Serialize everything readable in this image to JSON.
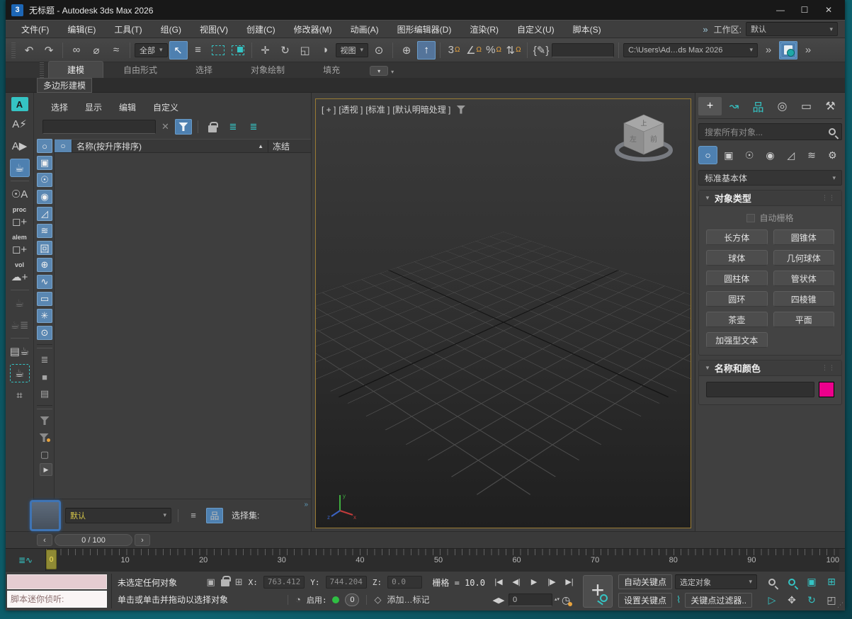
{
  "colors": {
    "accent_teal": "#35c4c4",
    "highlight_blue": "#4e80b0",
    "swatch_pink": "#ec008c",
    "active_viewport_border": "#9a7b33",
    "marker_yellow": "#8f8a35"
  },
  "window": {
    "app_badge": "3",
    "title": "无标题 - Autodesk 3ds Max 2026",
    "minimize": "—",
    "maximize": "☐",
    "close": "✕"
  },
  "menubar": {
    "items": [
      "文件(F)",
      "编辑(E)",
      "工具(T)",
      "组(G)",
      "视图(V)",
      "创建(C)",
      "修改器(M)",
      "动画(A)",
      "图形编辑器(D)",
      "渲染(R)",
      "自定义(U)",
      "脚本(S)"
    ],
    "overflow": "»",
    "workspace_label": "工作区:",
    "workspace_value": "默认"
  },
  "toolbar": {
    "items": [
      {
        "name": "undo-icon",
        "glyph": "↶"
      },
      {
        "name": "redo-icon",
        "glyph": "↷"
      },
      {
        "kind": "sep"
      },
      {
        "name": "select-and-link-icon",
        "glyph": "∞"
      },
      {
        "name": "unlink-selection-icon",
        "glyph": "⌀"
      },
      {
        "name": "bind-to-space-warp-icon",
        "glyph": "≈"
      },
      {
        "kind": "sep"
      },
      {
        "kind": "dropdown",
        "name": "selection-filter-dropdown",
        "value": "全部"
      },
      {
        "name": "select-object-icon",
        "glyph": "↖",
        "active": true
      },
      {
        "name": "select-by-name-icon",
        "glyph": "≡"
      },
      {
        "name": "rect-selection-region-icon",
        "css": "i-dash"
      },
      {
        "name": "window-crossing-icon",
        "css": "i-dash fill"
      },
      {
        "kind": "sep"
      },
      {
        "name": "select-and-move-icon",
        "glyph": "✛"
      },
      {
        "name": "select-and-rotate-icon",
        "glyph": "↻"
      },
      {
        "name": "select-and-scale-icon",
        "glyph": "◱"
      },
      {
        "name": "select-and-place-icon",
        "glyph": "◑"
      },
      {
        "kind": "dropdown",
        "name": "reference-coordinate-dropdown",
        "value": "视图"
      },
      {
        "name": "use-pivot-center-icon",
        "glyph": "⊙"
      },
      {
        "kind": "sep"
      },
      {
        "name": "select-and-manipulate-icon",
        "glyph": "⊕"
      },
      {
        "name": "keyboard-override-icon",
        "glyph": "↑",
        "active": true,
        "css": "boxed"
      },
      {
        "kind": "sep"
      },
      {
        "name": "snaps-toggle-3d-icon",
        "glyph": "3",
        "glyph2": "Ω"
      },
      {
        "name": "angle-snap-icon",
        "glyph": "∠",
        "glyph2": "Ω"
      },
      {
        "name": "percent-snap-icon",
        "glyph": "%",
        "glyph2": "Ω"
      },
      {
        "name": "spinner-snap-icon",
        "glyph": "⇅",
        "glyph2": "Ω"
      },
      {
        "kind": "sep"
      },
      {
        "name": "edit-named-selections-icon",
        "glyph": "{✎}"
      },
      {
        "kind": "field",
        "name": "named-selection-field",
        "value": "",
        "css": "w90"
      },
      {
        "kind": "sep"
      },
      {
        "kind": "dropdown",
        "name": "project-folder-dropdown",
        "value": "C:\\Users\\Ad…ds Max 2026",
        "css": "mono"
      },
      {
        "name": "toolbar-overflow-icon",
        "glyph": "»",
        "css": "tb-ovf"
      },
      {
        "name": "autosave-icon",
        "css": "i-disk",
        "active": true
      },
      {
        "name": "toolbar-overflow2-icon",
        "glyph": "»",
        "css": "tb-ovf"
      }
    ]
  },
  "ribbon": {
    "tabs": [
      {
        "name": "tab-modeling",
        "label": "建模",
        "active": true
      },
      {
        "name": "tab-freeform",
        "label": "自由形式"
      },
      {
        "name": "tab-selection",
        "label": "选择"
      },
      {
        "name": "tab-object-paint",
        "label": "对象绘制"
      },
      {
        "name": "tab-populate",
        "label": "填充"
      }
    ],
    "more_glyph": "▾",
    "subtab": "多边形建模"
  },
  "dock": {
    "items": [
      {
        "name": "script-editor-button",
        "glyph": "A",
        "css": "teal-box"
      },
      {
        "name": "script-run-button",
        "glyph": "A⚡"
      },
      {
        "name": "script-play-button",
        "glyph": "A▶"
      },
      {
        "name": "render-setup-button",
        "glyph": "☕",
        "active": true
      },
      {
        "kind": "sep"
      },
      {
        "name": "light-explorer-button",
        "glyph": "☉A"
      },
      {
        "name": "create-proc-button",
        "label": "proc",
        "glyph": "◻+"
      },
      {
        "name": "create-alem-button",
        "label": "alem",
        "glyph": "◻+"
      },
      {
        "name": "create-vol-button",
        "label": "vol",
        "glyph": "☁+"
      },
      {
        "kind": "sep"
      },
      {
        "name": "render-last-button",
        "glyph": "☕",
        "disabled": true
      },
      {
        "name": "render-list-button",
        "glyph": "☕≣",
        "disabled": true
      },
      {
        "kind": "sep"
      },
      {
        "name": "frame-buffer-button",
        "glyph": "▤☕"
      },
      {
        "name": "render-region-button",
        "glyph": "☕",
        "css": "dashed"
      },
      {
        "name": "state-sets-button",
        "glyph": "⌗"
      }
    ]
  },
  "explorer": {
    "menu": [
      "选择",
      "显示",
      "编辑",
      "自定义"
    ],
    "search_value": "",
    "clear_glyph": "✕",
    "name_column": "名称(按升序排序)",
    "sort_glyph": "▲",
    "frozen_column": "冻结",
    "type_header_glyph": "○",
    "filters": [
      {
        "name": "filter-geometry-icon",
        "glyph": "○",
        "active": true
      },
      {
        "name": "filter-shapes-icon",
        "glyph": "▣",
        "active": true
      },
      {
        "name": "filter-lights-icon",
        "glyph": "☉",
        "active": true
      },
      {
        "name": "filter-cameras-icon",
        "glyph": "◉",
        "active": true
      },
      {
        "name": "filter-helpers-icon",
        "glyph": "◿",
        "active": true
      },
      {
        "name": "filter-space-warps-icon",
        "glyph": "≋",
        "active": true
      },
      {
        "name": "filter-xrefs-icon",
        "glyph": "回",
        "active": true
      },
      {
        "name": "filter-containers-icon",
        "glyph": "⊕",
        "active": true
      },
      {
        "name": "filter-bones-icon",
        "glyph": "∿",
        "active": true
      },
      {
        "name": "filter-boxes-icon",
        "glyph": "▭",
        "active": true
      },
      {
        "name": "filter-particles-icon",
        "glyph": "✳",
        "active": true
      },
      {
        "name": "filter-visibility-icon",
        "glyph": "⊙",
        "active": true
      },
      {
        "kind": "gap"
      },
      {
        "name": "display-notes-icon",
        "glyph": "≣",
        "css": "gray"
      },
      {
        "name": "display-solid-icon",
        "glyph": "■",
        "css": "gray"
      },
      {
        "name": "display-list-icon",
        "glyph": "▤",
        "css": "gray"
      },
      {
        "kind": "gap"
      },
      {
        "name": "advanced-filter-icon",
        "css": "funnel"
      },
      {
        "name": "filter-settings-icon",
        "css": "funnel gear"
      },
      {
        "name": "filter-container-icon",
        "glyph": "▢",
        "css": "gray"
      }
    ],
    "layer_value": "默认",
    "layers_glyph": "≡",
    "hierarchy_glyph": "品",
    "selection_set_label": "选择集:",
    "overflow": "»",
    "expand_glyph": "▶"
  },
  "viewport": {
    "labels": [
      "[ + ]",
      "[透视 ]",
      "[标准 ]",
      "[默认明暗处理 ]"
    ],
    "viewcube": {
      "top": "上",
      "left": "左",
      "front": "前"
    },
    "axis": {
      "x": "x",
      "y": "y",
      "z": "z"
    }
  },
  "panel": {
    "tabs": [
      {
        "name": "tab-create",
        "glyph": "+",
        "active": true
      },
      {
        "name": "tab-modify",
        "glyph": "↝",
        "css": "teal"
      },
      {
        "name": "tab-hierarchy",
        "glyph": "品",
        "css": "teal"
      },
      {
        "name": "tab-motion",
        "glyph": "◎"
      },
      {
        "name": "tab-display",
        "glyph": "▭"
      },
      {
        "name": "tab-utilities",
        "glyph": "⚒"
      }
    ],
    "search_placeholder": "搜索所有对象...",
    "categories": [
      {
        "name": "category-geometry-icon",
        "glyph": "○",
        "active": true
      },
      {
        "name": "category-shapes-icon",
        "glyph": "▣"
      },
      {
        "name": "category-lights-icon",
        "glyph": "☉"
      },
      {
        "name": "category-cameras-icon",
        "glyph": "◉"
      },
      {
        "name": "category-helpers-icon",
        "glyph": "◿"
      },
      {
        "name": "category-space-warps-icon",
        "glyph": "≋"
      },
      {
        "name": "category-systems-icon",
        "glyph": "⚙"
      }
    ],
    "subcategory": "标准基本体",
    "object_type": {
      "title": "对象类型",
      "autogrid_label": "自动栅格",
      "buttons": [
        "长方体",
        "圆锥体",
        "球体",
        "几何球体",
        "圆柱体",
        "管状体",
        "圆环",
        "四棱锥",
        "茶壶",
        "平面",
        "加强型文本"
      ]
    },
    "name_color": {
      "title": "名称和颜色",
      "name_value": "",
      "color": "#ec008c"
    },
    "grip": "⋮⋮",
    "caret": "▼"
  },
  "timeline": {
    "prev": "‹",
    "next": "›",
    "counter": "0 / 100",
    "marker": "0",
    "ticks": [
      "0",
      "10",
      "20",
      "30",
      "40",
      "50",
      "60",
      "70",
      "80",
      "90",
      "100"
    ],
    "mini_curve_glyph": "≣∿"
  },
  "statusbar": {
    "listener_label": "脚本迷你侦听:",
    "status": "未选定任何对象",
    "prompt": "单击或单击并拖动以选择对象",
    "transform_icons": [
      {
        "name": "isolate-selection-icon",
        "glyph": "▣"
      },
      {
        "name": "selection-lock-icon",
        "css": "lock"
      },
      {
        "name": "absolute-offset-icon",
        "glyph": "⊞"
      }
    ],
    "x_label": "X:",
    "x": "763.412",
    "y_label": "Y:",
    "y": "744.204",
    "z_label": "Z:",
    "z": "0.0",
    "grid": "栅格 = 10.0",
    "anim_layer_glyph": "◔",
    "enable_label": "启用:",
    "counter_badge": "0",
    "cube_glyph": "◇",
    "add_tag": "添加…标记",
    "playback": [
      {
        "name": "go-to-start-button",
        "glyph": "|◀"
      },
      {
        "name": "previous-frame-button",
        "glyph": "◀|"
      },
      {
        "name": "play-button",
        "glyph": "▶"
      },
      {
        "name": "next-frame-button",
        "glyph": "|▶"
      },
      {
        "name": "go-to-end-button",
        "glyph": "▶|"
      }
    ],
    "key_mode_glyph": "◀▶",
    "frame_field": "0",
    "spinner_glyphs": "▴▾",
    "time_config_glyph": "◷",
    "autokey": "自动关键点",
    "setkey": "设置关键点",
    "key_target": "选定对象",
    "new_key_glyph": "⌇",
    "key_filters": "关键点过滤器..",
    "nav": [
      {
        "name": "zoom-icon",
        "css": "mag"
      },
      {
        "name": "zoom-all-icon",
        "css": "mag teal"
      },
      {
        "name": "zoom-extents-icon",
        "glyph": "▣",
        "css": "teal"
      },
      {
        "name": "zoom-extents-all-icon",
        "glyph": "⊞",
        "css": "teal"
      },
      {
        "name": "zoom-region-icon",
        "glyph": "▷",
        "css": "teal"
      },
      {
        "name": "pan-icon",
        "glyph": "✥"
      },
      {
        "name": "orbit-icon",
        "glyph": "↻",
        "css": "teal"
      },
      {
        "name": "maximize-viewport-icon",
        "glyph": "◰"
      }
    ],
    "resize_grip": "⋰"
  }
}
